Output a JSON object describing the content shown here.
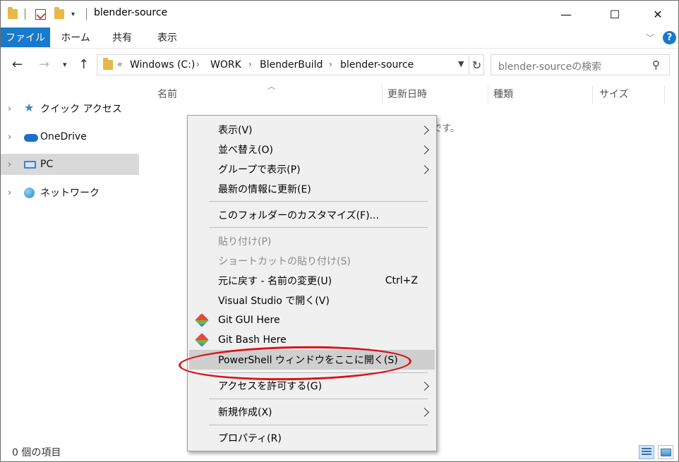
{
  "window": {
    "title": "blender-source",
    "controls": {
      "minimize": "—",
      "maximize": "☐",
      "close": "✕"
    },
    "qa_dropdown": "▾"
  },
  "ribbon": {
    "tabs": [
      {
        "label": "ファイル"
      },
      {
        "label": "ホーム"
      },
      {
        "label": "共有"
      },
      {
        "label": "表示"
      }
    ],
    "help": "?"
  },
  "address": {
    "overflow": "«",
    "breadcrumb": [
      "Windows (C:)",
      "WORK",
      "BlenderBuild",
      "blender-source"
    ],
    "separator": "›",
    "refresh": "↻"
  },
  "search": {
    "placeholder": "blender-sourceの検索"
  },
  "navpane": {
    "items": [
      {
        "label": "クイック アクセス",
        "icon": "star-icon"
      },
      {
        "label": "OneDrive",
        "icon": "cloud-icon"
      },
      {
        "label": "PC",
        "icon": "pc-icon",
        "selected": true
      },
      {
        "label": "ネットワーク",
        "icon": "network-icon"
      }
    ]
  },
  "columns": [
    "名前",
    "更新日時",
    "種類",
    "サイズ"
  ],
  "empty_text": "です。",
  "status": {
    "item_count": "0 個の項目"
  },
  "menu": {
    "items": [
      {
        "label": "表示(V)",
        "submenu": true
      },
      {
        "label": "並べ替え(O)",
        "submenu": true
      },
      {
        "label": "グループで表示(P)",
        "submenu": true
      },
      {
        "label": "最新の情報に更新(E)"
      },
      {
        "label": "このフォルダーのカスタマイズ(F)..."
      },
      {
        "label": "貼り付け(P)",
        "disabled": true
      },
      {
        "label": "ショートカットの貼り付け(S)",
        "disabled": true
      },
      {
        "label": "元に戻す - 名前の変更(U)",
        "shortcut": "Ctrl+Z"
      },
      {
        "label": "Visual Studio で開く(V)"
      },
      {
        "label": "Git GUI Here",
        "icon": "git-icon"
      },
      {
        "label": "Git Bash Here",
        "icon": "git-icon"
      },
      {
        "label": "PowerShell ウィンドウをここに開く(S)",
        "highlighted": true
      },
      {
        "label": "アクセスを許可する(G)",
        "submenu": true
      },
      {
        "label": "新規作成(X)",
        "submenu": true
      },
      {
        "label": "プロパティ(R)"
      }
    ]
  },
  "colors": {
    "accent": "#1979ca",
    "annotation": "#d9141a"
  }
}
